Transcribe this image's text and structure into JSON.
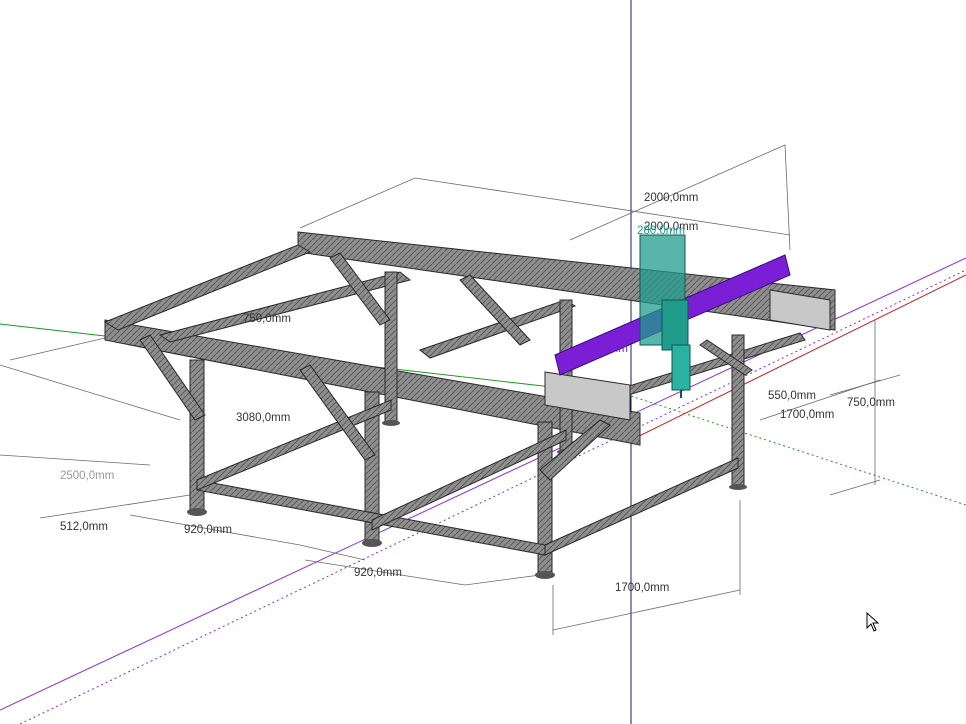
{
  "dimensions": {
    "top_2000": "2000,0mm",
    "top_2000_b": "2000,0mm",
    "gantry_280": "280,0mm",
    "upright_750": "750,0mm",
    "inner_280": "280,0mm",
    "length_3080": "3080,0mm",
    "len_2500": "2500,0mm",
    "foot_512": "512,0mm",
    "span_920_a": "920,0mm",
    "span_920_b": "920,0mm",
    "width_1700_front": "1700,0mm",
    "right_550": "550,0mm",
    "right_1700": "1700,0mm",
    "right_750": "750,0mm"
  },
  "colors": {
    "frame_fill": "#8c8c8c",
    "frame_dark": "#3a3a3a",
    "gantry_beam": "#7a1fd6",
    "spindle": "#1f9c8c",
    "axis_green": "#1a9a1a",
    "axis_red": "#c42020",
    "axis_blue": "#1a1a6a",
    "axis_purple": "#8a2be2",
    "dim_line": "#555555",
    "dim_text_dark": "#333333",
    "dim_text_light": "#9a9a9a",
    "dim_text_teal": "#1f9c8c"
  },
  "icons": {
    "cursor": "arrow-cursor-icon"
  }
}
